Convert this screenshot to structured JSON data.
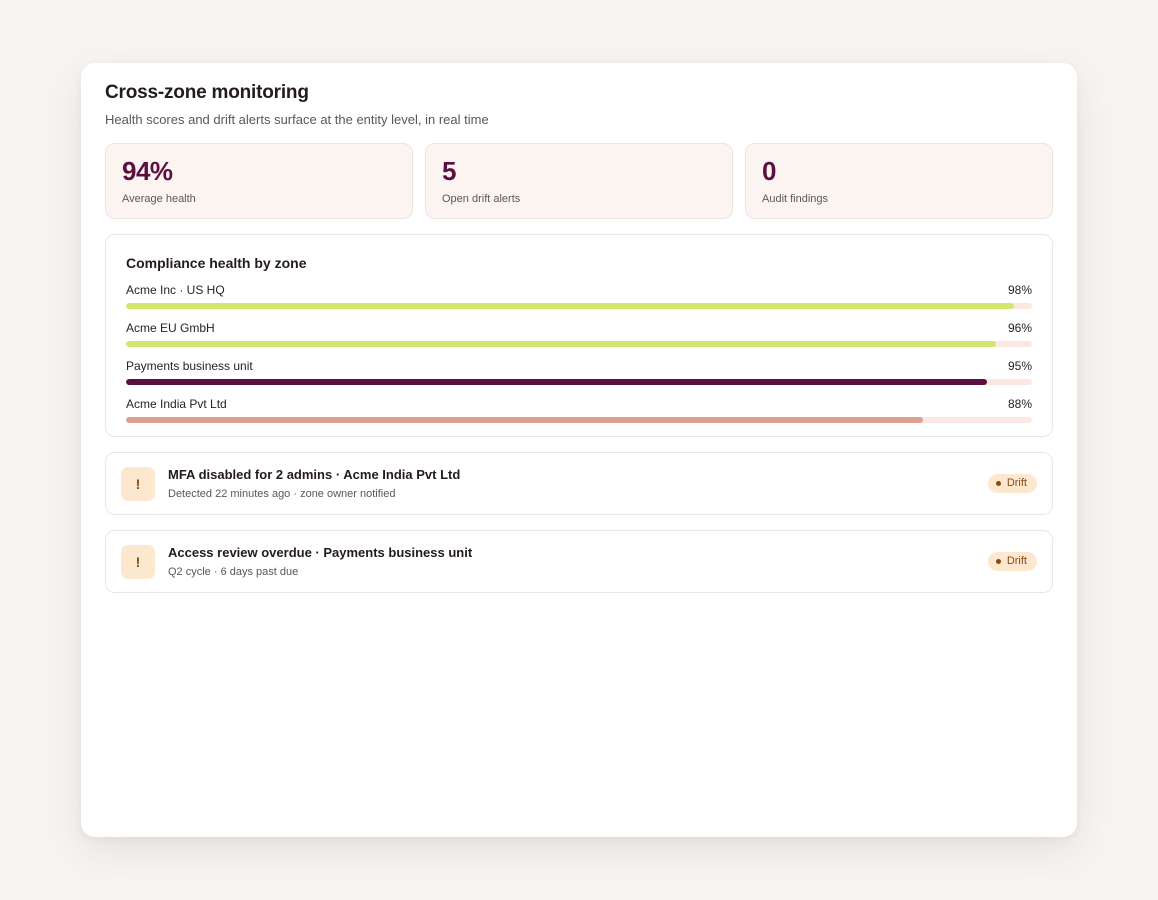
{
  "panel": {
    "title": "Cross-zone monitoring",
    "subtitle": "Health scores and drift alerts surface at the entity level, in real time"
  },
  "stats": [
    {
      "value": "94%",
      "label": "Average health"
    },
    {
      "value": "5",
      "label": "Open drift alerts"
    },
    {
      "value": "0",
      "label": "Audit findings"
    }
  ],
  "zones": {
    "title": "Compliance health by zone",
    "items": [
      {
        "name": "Acme Inc · US HQ",
        "percent_label": "98%",
        "percent": 98,
        "color": "#d3e66d",
        "track_color": "#fbe8e3"
      },
      {
        "name": "Acme EU GmbH",
        "percent_label": "96%",
        "percent": 96,
        "color": "#d3e66d",
        "track_color": "#fbe8e3"
      },
      {
        "name": "Payments business unit",
        "percent_label": "95%",
        "percent": 95,
        "color": "#5b0f3e",
        "track_color": "#fbe8e3"
      },
      {
        "name": "Acme India Pvt Ltd",
        "percent_label": "88%",
        "percent": 88,
        "color": "#dca090",
        "track_color": "#fbe8e3"
      }
    ]
  },
  "alerts": [
    {
      "icon": "exclamation-icon",
      "icon_glyph": "!",
      "title": "MFA disabled for 2 admins · Acme India Pvt Ltd",
      "meta": "Detected 22 minutes ago · zone owner notified",
      "badge": "Drift"
    },
    {
      "icon": "exclamation-icon",
      "icon_glyph": "!",
      "title": "Access review overdue · Payments business unit",
      "meta": "Q2 cycle · 6 days past due",
      "badge": "Drift"
    }
  ]
}
